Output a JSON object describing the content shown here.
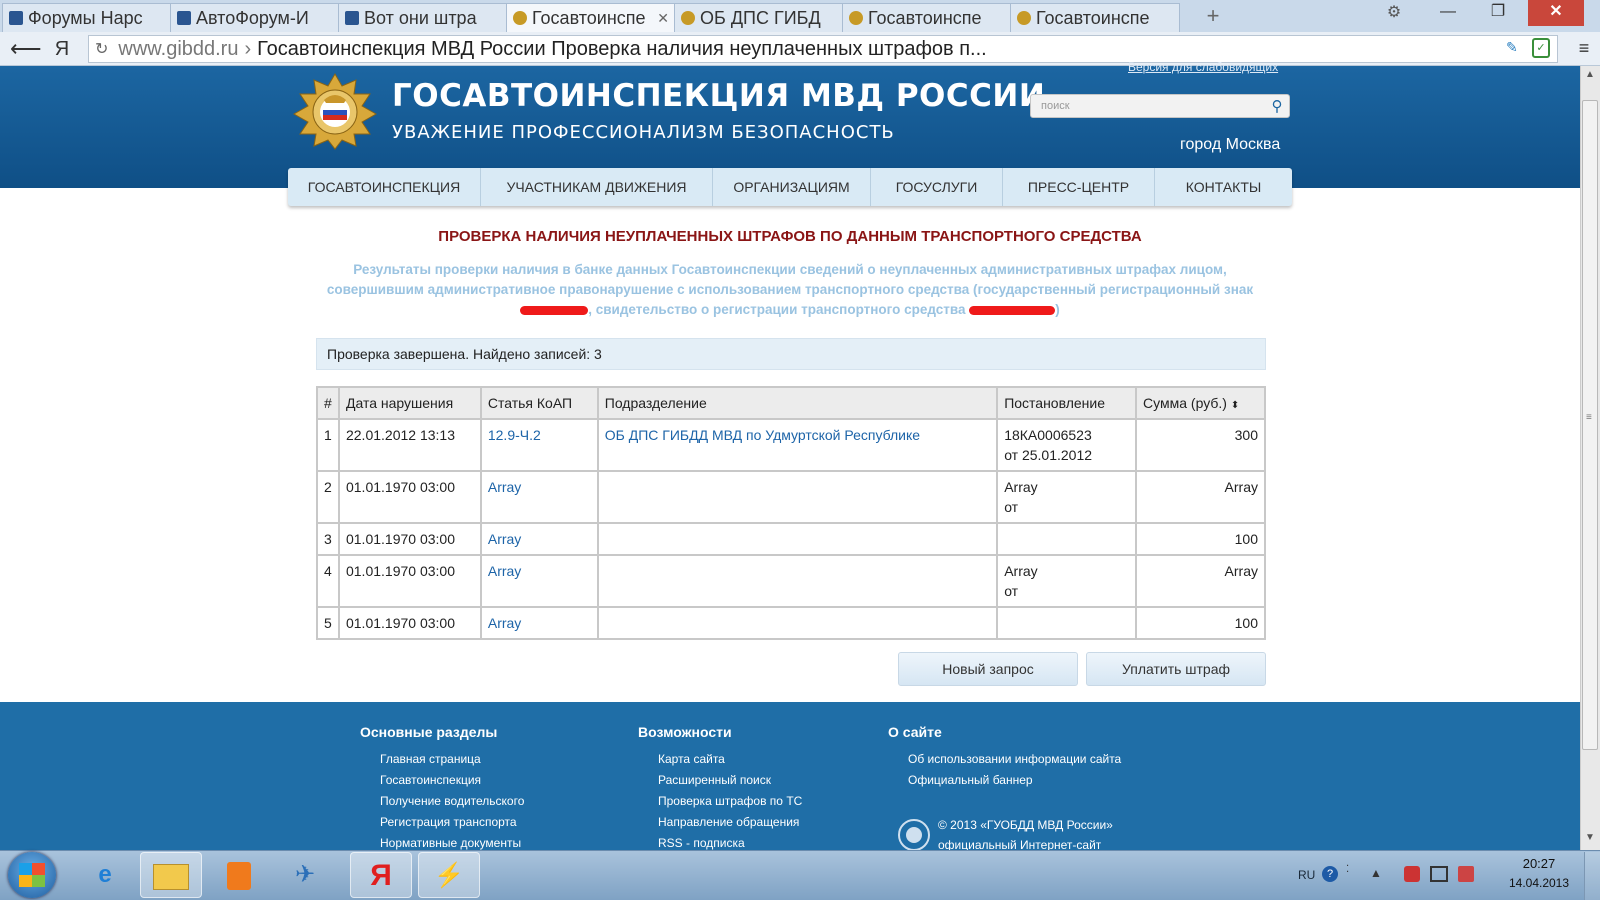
{
  "browser": {
    "tabs": [
      {
        "label": "Форумы Нарс",
        "icon": "mail-icon",
        "active": false
      },
      {
        "label": "АвтоФорум-И",
        "icon": "mail-icon",
        "active": false
      },
      {
        "label": "Вот они штра",
        "icon": "mail-icon",
        "active": false
      },
      {
        "label": "Госавтоинспе",
        "icon": "gibdd-emblem-icon",
        "active": true
      },
      {
        "label": "ОБ ДПС ГИБД",
        "icon": "gibdd-emblem-icon",
        "active": false
      },
      {
        "label": "Госавтоинспе",
        "icon": "gibdd-emblem-icon",
        "active": false
      },
      {
        "label": "Госавтоинспе",
        "icon": "gibdd-emblem-icon",
        "active": false
      }
    ],
    "address": {
      "host": "www.gibdd.ru",
      "sep": "›",
      "title": "Госавтоинспекция МВД России Проверка наличия неуплаченных штрафов п..."
    }
  },
  "site": {
    "title": "ГОСАВТОИНСПЕКЦИЯ МВД РОССИИ",
    "motto": "УВАЖЕНИЕ  ПРОФЕССИОНАЛИЗМ  БЕЗОПАСНОСТЬ",
    "low_vision": "Версия для слабовидящих",
    "search_placeholder": "поиск",
    "city": "город Москва",
    "nav": [
      "ГОСАВТОИНСПЕКЦИЯ",
      "УЧАСТНИКАМ ДВИЖЕНИЯ",
      "ОРГАНИЗАЦИЯМ",
      "ГОСУСЛУГИ",
      "ПРЕСС-ЦЕНТР",
      "КОНТАКТЫ"
    ]
  },
  "content": {
    "heading": "ПРОВЕРКА НАЛИЧИЯ НЕУПЛАЧЕННЫХ ШТРАФОВ ПО ДАННЫМ ТРАНСПОРТНОГО СРЕДСТВА",
    "intro_1": "Результаты проверки наличия в банке данных Госавтоинспекции сведений о неуплаченных административных штрафах лицом, совершившим административное правонарушение с использованием транспортного средства (государственный регистрационный знак ",
    "intro_2": ", свидетельство о регистрации транспортного средства ",
    "intro_3": ")",
    "status": "Проверка завершена. Найдено записей: 3",
    "columns": [
      "#",
      "Дата нарушения",
      "Статья КоАП",
      "Подразделение",
      "Постановление",
      "Сумма (руб.)"
    ],
    "sort_icon": "sort-icon",
    "rows": [
      {
        "n": "1",
        "date": "22.01.2012 13:13",
        "article": "12.9-Ч.2",
        "dept": "ОБ ДПС ГИБДД МВД по Удмуртской Республике",
        "decision": "18КА0006523",
        "decision_date": "от 25.01.2012",
        "sum": "300"
      },
      {
        "n": "2",
        "date": "01.01.1970 03:00",
        "article": "Array",
        "dept": "",
        "decision": "Array",
        "decision_date": "от",
        "sum": "Array"
      },
      {
        "n": "3",
        "date": "01.01.1970 03:00",
        "article": "Array",
        "dept": "",
        "decision": "",
        "decision_date": "",
        "sum": "100"
      },
      {
        "n": "4",
        "date": "01.01.1970 03:00",
        "article": "Array",
        "dept": "",
        "decision": "Array",
        "decision_date": "от",
        "sum": "Array"
      },
      {
        "n": "5",
        "date": "01.01.1970 03:00",
        "article": "Array",
        "dept": "",
        "decision": "",
        "decision_date": "",
        "sum": "100"
      }
    ],
    "btn_new": "Новый запрос",
    "btn_pay": "Уплатить штраф"
  },
  "footer": {
    "col1": {
      "title": "Основные разделы",
      "links": [
        "Главная страница",
        "Госавтоинспекция",
        "Получение водительского",
        "Регистрация транспорта",
        "Нормативные документы"
      ]
    },
    "col2": {
      "title": "Возможности",
      "links": [
        "Карта сайта",
        "Расширенный поиск",
        "Проверка штрафов по ТС",
        "Направление обращения",
        "RSS - подписка"
      ]
    },
    "col3": {
      "title": "О сайте",
      "links": [
        "Об использовании информации сайта",
        "Официальный баннер"
      ]
    },
    "copyright": "© 2013 «ГУОБДД МВД России»",
    "official": "официальный Интернет-сайт"
  },
  "taskbar": {
    "lang": "RU",
    "time": "20:27",
    "date": "14.04.2013",
    "apps": [
      "start-icon",
      "internet-explorer-icon",
      "file-explorer-icon",
      "media-player-icon",
      "connection-icon",
      "yandex-browser-icon",
      "winamp-icon"
    ]
  },
  "colors": {
    "header_blue": "#1c66a2",
    "heading_red": "#8a1515",
    "link_blue": "#1d64a8",
    "intro_blue": "#9ac3e1",
    "redaction_red": "#ef1a1a"
  }
}
